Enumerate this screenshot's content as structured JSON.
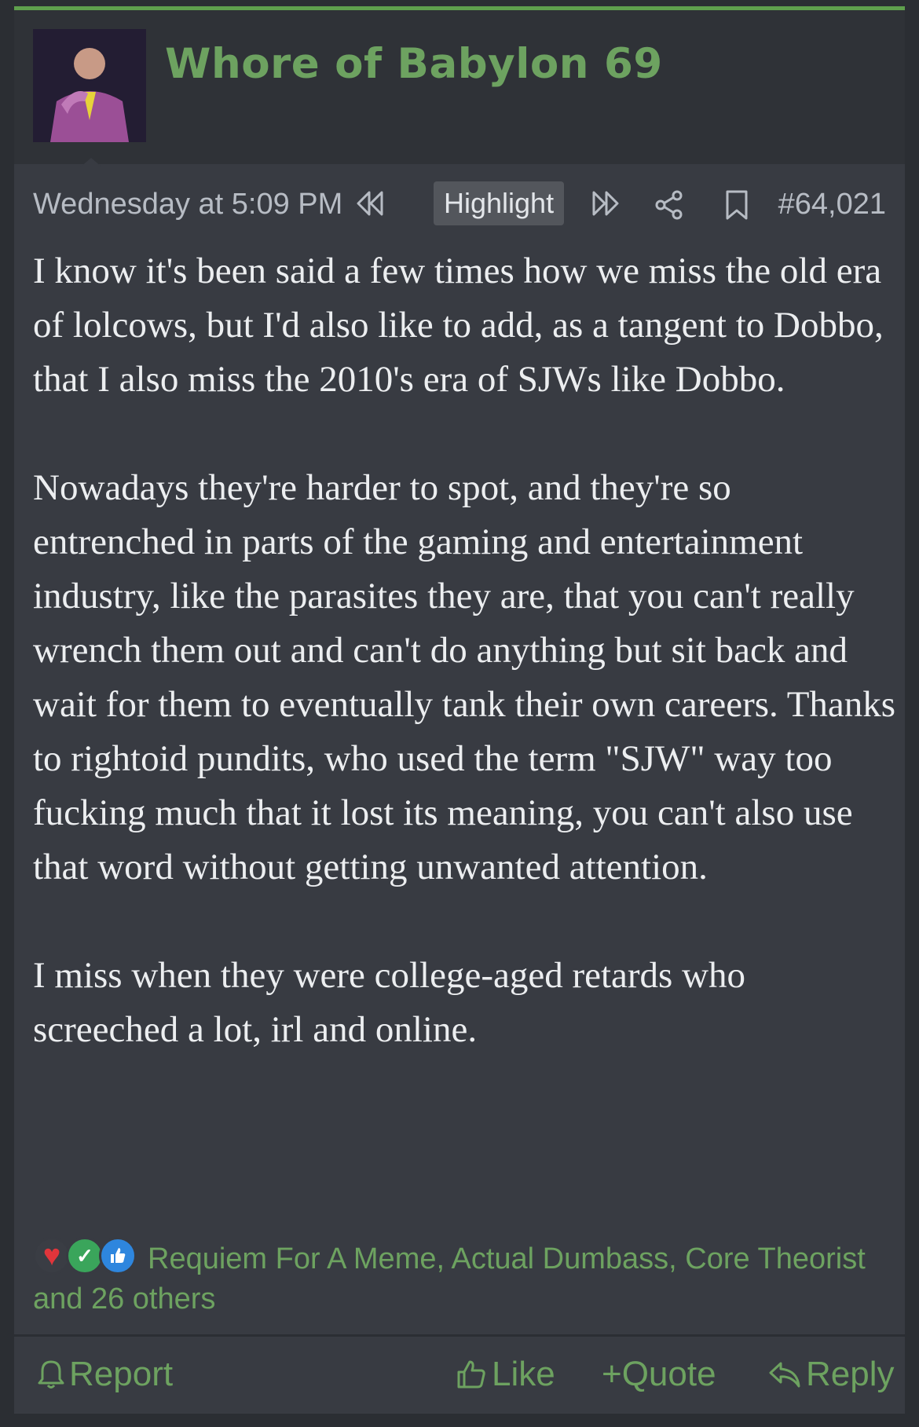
{
  "post": {
    "author": "Whore of Babylon 69",
    "date": "Wednesday at 5:09 PM",
    "highlight_label": "Highlight",
    "post_number": "#64,021",
    "paragraphs": [
      "I know it's been said a few times how we miss the old era of lolcows, but I'd also like to add, as a tangent to Dobbo, that I also miss the 2010's era of SJWs like Dobbo.",
      "Nowadays they're harder to spot, and they're so entrenched in parts of the gaming and entertainment industry, like the parasites they are, that you can't really wrench them out and can't do anything but sit back and wait for them to eventually tank their own careers. Thanks to rightoid pundits, who used the term \"SJW\" way too fucking much that it lost its meaning, you can't also use that word without getting unwanted attention.",
      "I miss when they were college-aged retards who screeched a lot, irl and online."
    ],
    "reactions_text": "Requiem For A Meme, Actual Dumbass, Core Theorist and 26 others",
    "reaction_icons": [
      "heart-icon",
      "check-icon",
      "thumbs-up-icon"
    ]
  },
  "actions": {
    "report": "Report",
    "like": "Like",
    "quote": "Quote",
    "reply": "Reply"
  },
  "colors": {
    "accent_green": "#6da260",
    "post_bg": "#383b42",
    "header_bg": "#2f3237",
    "text": "#eceef0",
    "meta_text": "#b7bcc4"
  }
}
